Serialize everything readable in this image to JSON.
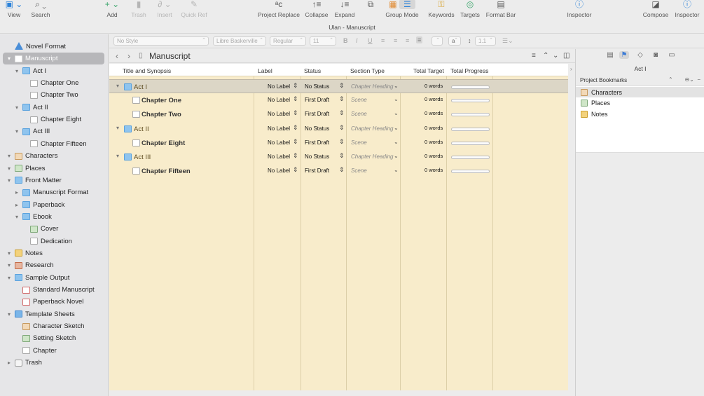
{
  "window_title": "Ulan - Manuscript",
  "toolbar": [
    {
      "id": "view",
      "label": "View",
      "icon": "▣",
      "style": "blue"
    },
    {
      "id": "search",
      "label": "Search",
      "icon": "⌕",
      "style": ""
    },
    {
      "id": "add",
      "label": "Add",
      "icon": "+",
      "style": "green"
    },
    {
      "id": "trash",
      "label": "Trash",
      "icon": "🗑",
      "style": "dim"
    },
    {
      "id": "insert",
      "label": "Insert",
      "icon": "📎",
      "style": "dim"
    },
    {
      "id": "quick-ref",
      "label": "Quick Ref",
      "icon": "✎",
      "style": "dim"
    },
    {
      "id": "project-replace",
      "label": "Project Replace",
      "icon": "ᵃc",
      "style": ""
    },
    {
      "id": "collapse",
      "label": "Collapse",
      "icon": "↑≡",
      "style": ""
    },
    {
      "id": "expand",
      "label": "Expand",
      "icon": "↓≡",
      "style": ""
    },
    {
      "id": "copy",
      "label": "",
      "icon": "⧉",
      "style": ""
    },
    {
      "id": "group-mode",
      "label": "Group Mode",
      "icon": "▦ ☰",
      "style": "orange"
    },
    {
      "id": "keywords",
      "label": "Keywords",
      "icon": "⚿",
      "style": "gold"
    },
    {
      "id": "targets",
      "label": "Targets",
      "icon": "◎",
      "style": "green"
    },
    {
      "id": "format-bar",
      "label": "Format Bar",
      "icon": "▤",
      "style": ""
    },
    {
      "id": "inspector-left",
      "label": "Inspector",
      "icon": "ⓘ",
      "style": "blue"
    },
    {
      "id": "compose",
      "label": "Compose",
      "icon": "◪",
      "style": ""
    },
    {
      "id": "inspector",
      "label": "Inspector",
      "icon": "ⓘ",
      "style": "blue"
    }
  ],
  "formatbar": {
    "style": "No Style",
    "font": "Libre Baskerville",
    "weight": "Regular",
    "size": "11",
    "bold": "B",
    "italic": "I",
    "underline": "U",
    "text_color": "a",
    "line_spacing": "1.1"
  },
  "editor": {
    "title": "Manuscript",
    "columns": [
      "Title and Synopsis",
      "Label",
      "Status",
      "Section Type",
      "Total Target",
      "Total Progress"
    ],
    "rows": [
      {
        "title": "Act I",
        "kind": "folder",
        "label": "No Label",
        "status": "No Status",
        "section": "Chapter Heading",
        "target": "0 words"
      },
      {
        "title": "Chapter One",
        "kind": "doc",
        "label": "No Label",
        "status": "First Draft",
        "section": "Scene",
        "target": "0 words"
      },
      {
        "title": "Chapter Two",
        "kind": "doc",
        "label": "No Label",
        "status": "First Draft",
        "section": "Scene",
        "target": "0 words"
      },
      {
        "title": "Act II",
        "kind": "folder",
        "label": "No Label",
        "status": "No Status",
        "section": "Chapter Heading",
        "target": "0 words"
      },
      {
        "title": "Chapter Eight",
        "kind": "doc",
        "label": "No Label",
        "status": "First Draft",
        "section": "Scene",
        "target": "0 words"
      },
      {
        "title": "Act III",
        "kind": "folder",
        "label": "No Label",
        "status": "No Status",
        "section": "Chapter Heading",
        "target": "0 words"
      },
      {
        "title": "Chapter Fifteen",
        "kind": "doc",
        "label": "No Label",
        "status": "First Draft",
        "section": "Scene",
        "target": "0 words"
      }
    ]
  },
  "binder": [
    {
      "label": "Novel Format",
      "icon": "format",
      "level": 0,
      "disclosure": ""
    },
    {
      "label": "Manuscript",
      "icon": "docsel",
      "level": 0,
      "disclosure": "▾",
      "selected": true
    },
    {
      "label": "Act I",
      "icon": "folder",
      "level": 1,
      "disclosure": "▾"
    },
    {
      "label": "Chapter One",
      "icon": "doc",
      "level": 2,
      "disclosure": ""
    },
    {
      "label": "Chapter Two",
      "icon": "doc",
      "level": 2,
      "disclosure": ""
    },
    {
      "label": "Act II",
      "icon": "folder",
      "level": 1,
      "disclosure": "▾"
    },
    {
      "label": "Chapter Eight",
      "icon": "doc",
      "level": 2,
      "disclosure": ""
    },
    {
      "label": "Act III",
      "icon": "folder",
      "level": 1,
      "disclosure": "▾"
    },
    {
      "label": "Chapter Fifteen",
      "icon": "doc",
      "level": 2,
      "disclosure": ""
    },
    {
      "label": "Characters",
      "icon": "char",
      "level": 0,
      "disclosure": "▾"
    },
    {
      "label": "Places",
      "icon": "place",
      "level": 0,
      "disclosure": "▾"
    },
    {
      "label": "Front Matter",
      "icon": "folder",
      "level": 0,
      "disclosure": "▾"
    },
    {
      "label": "Manuscript Format",
      "icon": "folder",
      "level": 1,
      "disclosure": "▸"
    },
    {
      "label": "Paperback",
      "icon": "folder",
      "level": 1,
      "disclosure": "▸"
    },
    {
      "label": "Ebook",
      "icon": "folder",
      "level": 1,
      "disclosure": "▾"
    },
    {
      "label": "Cover",
      "icon": "place",
      "level": 2,
      "disclosure": ""
    },
    {
      "label": "Dedication",
      "icon": "doc",
      "level": 2,
      "disclosure": ""
    },
    {
      "label": "Notes",
      "icon": "notes",
      "level": 0,
      "disclosure": "▾"
    },
    {
      "label": "Research",
      "icon": "research",
      "level": 0,
      "disclosure": "▾"
    },
    {
      "label": "Sample Output",
      "icon": "sample",
      "level": 0,
      "disclosure": "▾"
    },
    {
      "label": "Standard Manuscript",
      "icon": "redpage",
      "level": 1,
      "disclosure": ""
    },
    {
      "label": "Paperback Novel",
      "icon": "redpage",
      "level": 1,
      "disclosure": ""
    },
    {
      "label": "Template Sheets",
      "icon": "template",
      "level": 0,
      "disclosure": "▾"
    },
    {
      "label": "Character Sketch",
      "icon": "char",
      "level": 1,
      "disclosure": ""
    },
    {
      "label": "Setting Sketch",
      "icon": "place",
      "level": 1,
      "disclosure": ""
    },
    {
      "label": "Chapter",
      "icon": "doc",
      "level": 1,
      "disclosure": ""
    },
    {
      "label": "Trash",
      "icon": "trash",
      "level": 0,
      "disclosure": "▸"
    }
  ],
  "inspector": {
    "subject": "Act I",
    "bookmarks_title": "Project Bookmarks",
    "bookmarks": [
      {
        "label": "Characters",
        "icon": "char"
      },
      {
        "label": "Places",
        "icon": "place"
      },
      {
        "label": "Notes",
        "icon": "notes"
      }
    ],
    "tab_icons": [
      "notes-icon",
      "bookmark-icon",
      "tag-icon",
      "snapshot-icon",
      "comment-icon"
    ]
  }
}
